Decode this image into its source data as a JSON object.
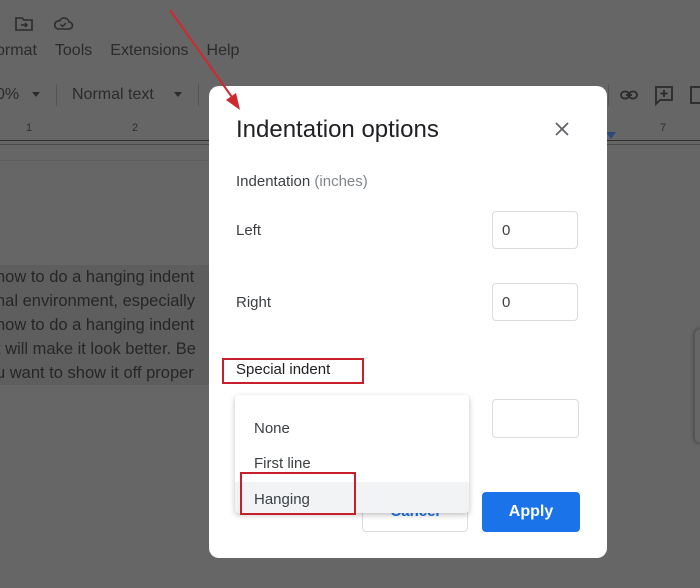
{
  "app": {
    "menu": [
      "ormat",
      "Tools",
      "Extensions",
      "Help"
    ],
    "toolbar": {
      "zoom_value": "0%",
      "paragraph_style": "Normal text"
    },
    "ruler": {
      "labels": [
        "1",
        "2",
        "7"
      ]
    },
    "document_lines": [
      "how to do a hanging indent",
      "nal environment, especially",
      "how to do a hanging indent",
      "t will make it look better. Be",
      "u want to show it off proper"
    ]
  },
  "dialog": {
    "title": "Indentation options",
    "section_heading": "Indentation",
    "section_unit": "(inches)",
    "left_label": "Left",
    "left_value": "0",
    "right_label": "Right",
    "right_value": "0",
    "special_indent_label": "Special indent",
    "special_indent_by_value": "",
    "dropdown_options": [
      "None",
      "First line",
      "Hanging"
    ],
    "highlighted_option": "Hanging",
    "cancel_label": "Cancel",
    "apply_label": "Apply"
  },
  "colors": {
    "accent": "#1a73e8",
    "annotation_red": "#c8202a",
    "overlay": "#666666"
  }
}
